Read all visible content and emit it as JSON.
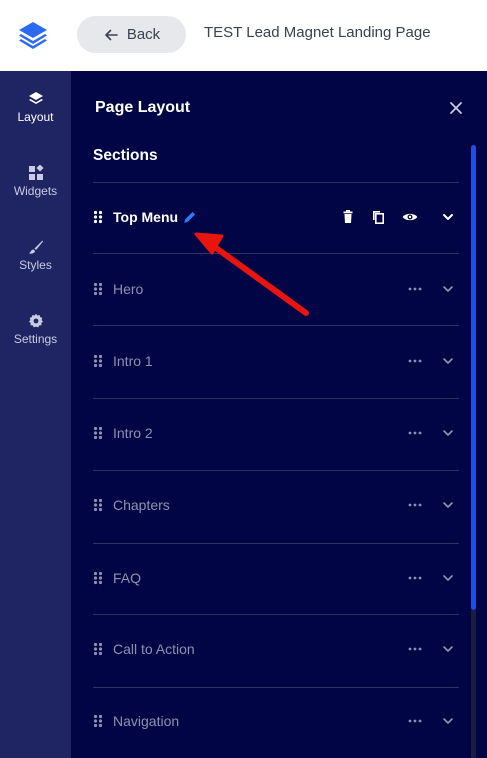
{
  "header": {
    "back_label": "Back",
    "page_title": "TEST Lead Magnet Landing Page"
  },
  "rail": {
    "items": [
      {
        "label": "Layout",
        "icon": "layers-icon",
        "active": true
      },
      {
        "label": "Widgets",
        "icon": "widgets-icon",
        "active": false
      },
      {
        "label": "Styles",
        "icon": "brush-icon",
        "active": false
      },
      {
        "label": "Settings",
        "icon": "gear-icon",
        "active": false
      }
    ]
  },
  "panel": {
    "title": "Page Layout",
    "sections_heading": "Sections",
    "sections": [
      {
        "label": "Top Menu",
        "active": true
      },
      {
        "label": "Hero",
        "active": false
      },
      {
        "label": "Intro 1",
        "active": false
      },
      {
        "label": "Intro 2",
        "active": false
      },
      {
        "label": "Chapters",
        "active": false
      },
      {
        "label": "FAQ",
        "active": false
      },
      {
        "label": "Call to Action",
        "active": false
      },
      {
        "label": "Navigation",
        "active": false
      }
    ]
  },
  "colors": {
    "panel_bg": "#020545",
    "rail_bg": "#1f2562",
    "accent_blue": "#2150e0",
    "pencil_blue": "#2f7bff",
    "annotation_red": "#e8150f"
  }
}
